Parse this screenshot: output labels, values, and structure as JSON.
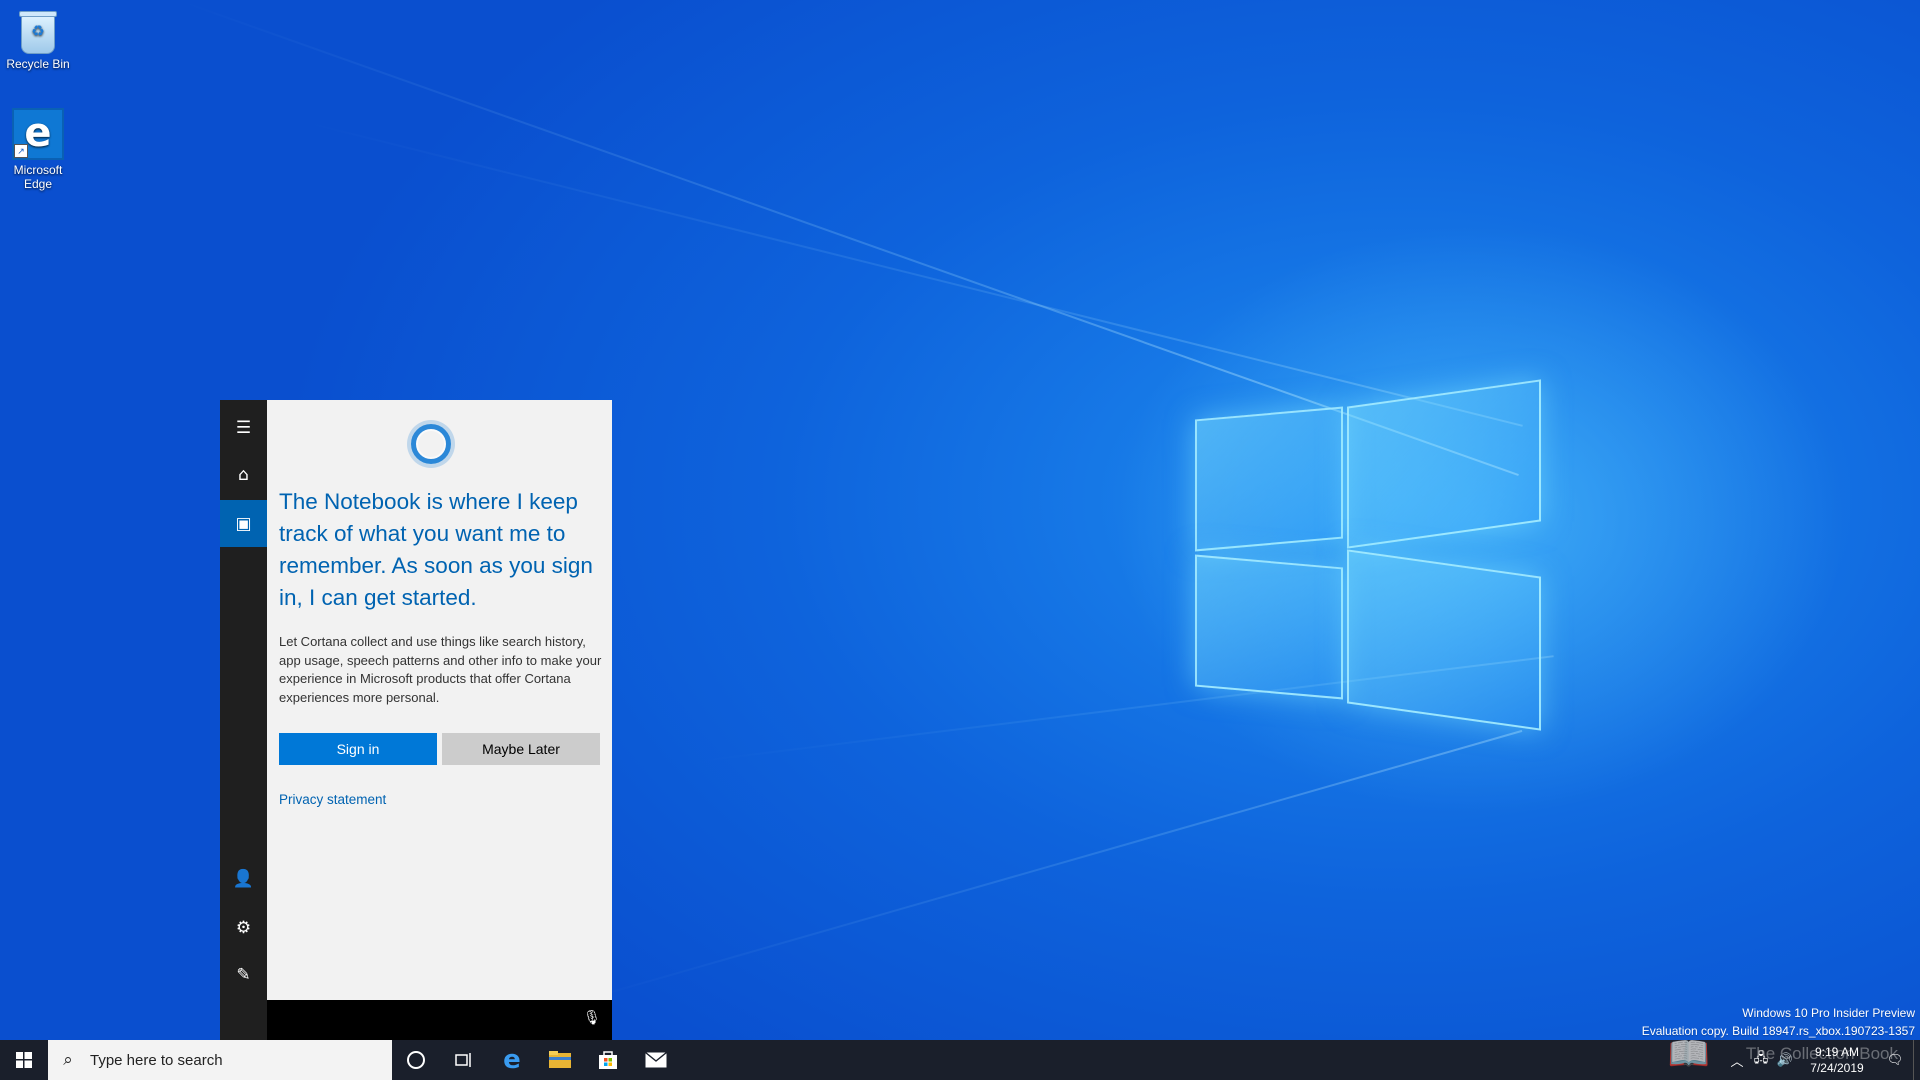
{
  "desktop": {
    "icons": [
      {
        "label": "Recycle Bin",
        "icon": "recycle-bin-icon"
      },
      {
        "label": "Microsoft Edge",
        "icon": "edge-icon"
      }
    ]
  },
  "cortana": {
    "rail": {
      "menu_icon": "hamburger-menu-icon",
      "home_icon": "home-icon",
      "notebook_icon": "notebook-icon",
      "account_icon": "account-icon",
      "settings_icon": "gear-icon",
      "feedback_icon": "feedback-icon",
      "active": "notebook"
    },
    "headline": "The Notebook is where I keep track of what you want me to remember. As soon as you sign in, I can get started.",
    "description": "Let Cortana collect and use things like search history, app usage, speech patterns and other info to make your experience in Microsoft products that offer Cortana experiences more personal.",
    "sign_in_label": "Sign in",
    "maybe_later_label": "Maybe Later",
    "privacy_label": "Privacy statement",
    "mic_icon": "microphone-icon",
    "colors": {
      "accent": "#0078d7",
      "headline": "#0063b1",
      "rail": "#1f1f1f"
    }
  },
  "watermark": {
    "line1": "Windows 10 Pro Insider Preview",
    "line2": "Evaluation copy. Build 18947.rs_xbox.190723-1357"
  },
  "overlay": {
    "text": "The Collection Book",
    "icon": "book-icon"
  },
  "taskbar": {
    "search_placeholder": "Type here to search",
    "pinned": [
      "start-icon",
      "cortana-icon",
      "task-view-icon",
      "edge-icon",
      "file-explorer-icon",
      "store-icon",
      "mail-icon"
    ],
    "clock_time": "9:19 AM",
    "clock_date": "7/24/2019",
    "tray_icons": [
      "chevron-up-icon",
      "network-icon",
      "volume-icon",
      "notification-icon"
    ]
  }
}
